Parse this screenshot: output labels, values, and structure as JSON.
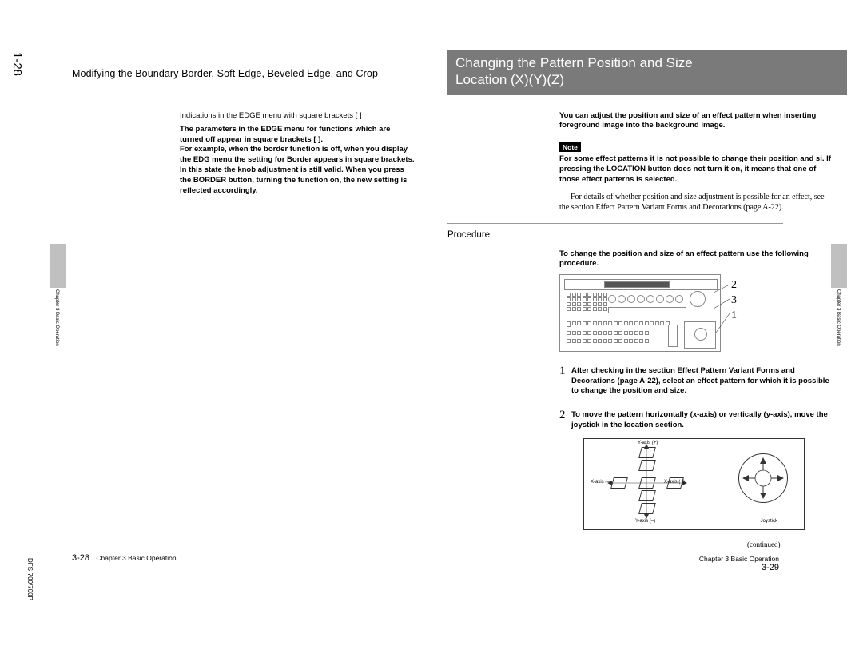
{
  "meta": {
    "page_tab": "1-28",
    "model": "DFS-700/700P",
    "chapter_label": "Chapter 3  Basic Operation"
  },
  "left": {
    "header": "Modifying the Boundary   Border, Soft Edge, Beveled Edge, and Crop",
    "sub": "Indications in the EDGE menu with square brackets [ ]",
    "p1": "The parameters in the EDGE menu for functions which are turned off appear in square brackets [ ].",
    "p2": "For example, when the border function is off, when you display the EDG menu the setting for Border appears in square brackets.",
    "p3": "In this state the knob adjustment is still valid. When you press the BORDER button, turning the function on, the new setting is reflected accordingly.",
    "footer_page": "3-28"
  },
  "right": {
    "banner_line1": "Changing the Pattern Position and Size",
    "banner_line2": "Location (X)(Y)(Z)",
    "intro": "You can adjust the position and size of an effect pattern when inserting foreground image into the background image.",
    "note_label": "Note",
    "note_body": "For some effect patterns it is not possible to change their position and si. If pressing the LOCATION button does not turn it on, it means that one of those effect patterns is selected.",
    "detail_serif": "For details of whether position and size adjustment is possible for an effect, see the section  Effect Pattern Variant Forms and Decorations  (page A-22).",
    "procedure_label": "Procedure",
    "proc_intro": "To change the position and size of an effect pattern use the following procedure.",
    "callouts": [
      "2",
      "3",
      "1"
    ],
    "step1_num": "1",
    "step1": "After checking in the section  Effect Pattern Variant Forms and Decorations (page A-22), select an effect pattern for which it is possible to change the position and size.",
    "step2_num": "2",
    "step2": "To move the pattern horizontally (x-axis) or vertically (y-axis), move the joystick in the location section.",
    "axis": {
      "y_plus": "Y-axis (+)",
      "y_minus": "Y-axis (–)",
      "x_plus": "X-axis (+)",
      "x_minus": "X-axis (–)",
      "joystick": "Joystick"
    },
    "continued": "(continued)",
    "footer_page": "3-29"
  }
}
